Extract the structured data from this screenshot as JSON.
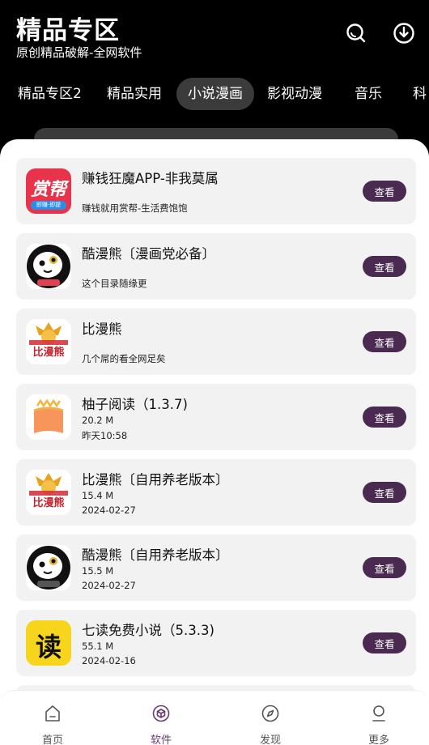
{
  "header": {
    "title": "精品专区",
    "subtitle": "原创精品破解-全网软件"
  },
  "tabs": [
    {
      "label": "精品专区2"
    },
    {
      "label": "精品实用"
    },
    {
      "label": "小说漫画"
    },
    {
      "label": "影视动漫"
    },
    {
      "label": "音乐"
    },
    {
      "label": "科"
    }
  ],
  "active_tab": "小说漫画",
  "apps": [
    {
      "name": "赚钱狂魔APP-非我莫属",
      "desc": "赚钱就用赏帮-生活费饱饱",
      "icon": "shangbang-icon",
      "icon_text": "赏帮",
      "icon_subtext": "即赚·即提",
      "button": "查看"
    },
    {
      "name": "酷漫熊〔漫画党必备〕",
      "desc": "这个目录随缘更",
      "icon": "kumanxiong-icon",
      "icon_text": "",
      "button": "查看"
    },
    {
      "name": "比漫熊",
      "desc": "几个屌的看全网足矣",
      "icon": "bimanxiong-icon",
      "icon_text": "比漫熊",
      "button": "查看"
    },
    {
      "name": "柚子阅读（1.3.7)",
      "size": "20.2 M",
      "date": "昨天10:58",
      "icon": "book-icon",
      "button": "查看"
    },
    {
      "name": "比漫熊〔自用养老版本〕",
      "size": "15.4 M",
      "date": "2024-02-27",
      "icon": "bimanxiong-icon",
      "icon_text": "比漫熊",
      "button": "查看"
    },
    {
      "name": "酷漫熊〔自用养老版本〕",
      "size": "15.5 M",
      "date": "2024-02-27",
      "icon": "kumanxiong-icon",
      "button": "查看"
    },
    {
      "name": "七读免费小说（5.3.3)",
      "size": "55.1 M",
      "date": "2024-02-16",
      "icon": "qidu-icon",
      "icon_text": "读",
      "button": "查看"
    }
  ],
  "nav": [
    {
      "label": "首页",
      "icon": "home-icon"
    },
    {
      "label": "软件",
      "icon": "box-icon",
      "active": true
    },
    {
      "label": "发现",
      "icon": "compass-icon"
    },
    {
      "label": "更多",
      "icon": "user-icon"
    }
  ],
  "colors": {
    "header_bg": "#000000",
    "button_bg": "#4a2a50",
    "nav_active": "#6b3a72",
    "card_bg": "#f2f2f2"
  }
}
